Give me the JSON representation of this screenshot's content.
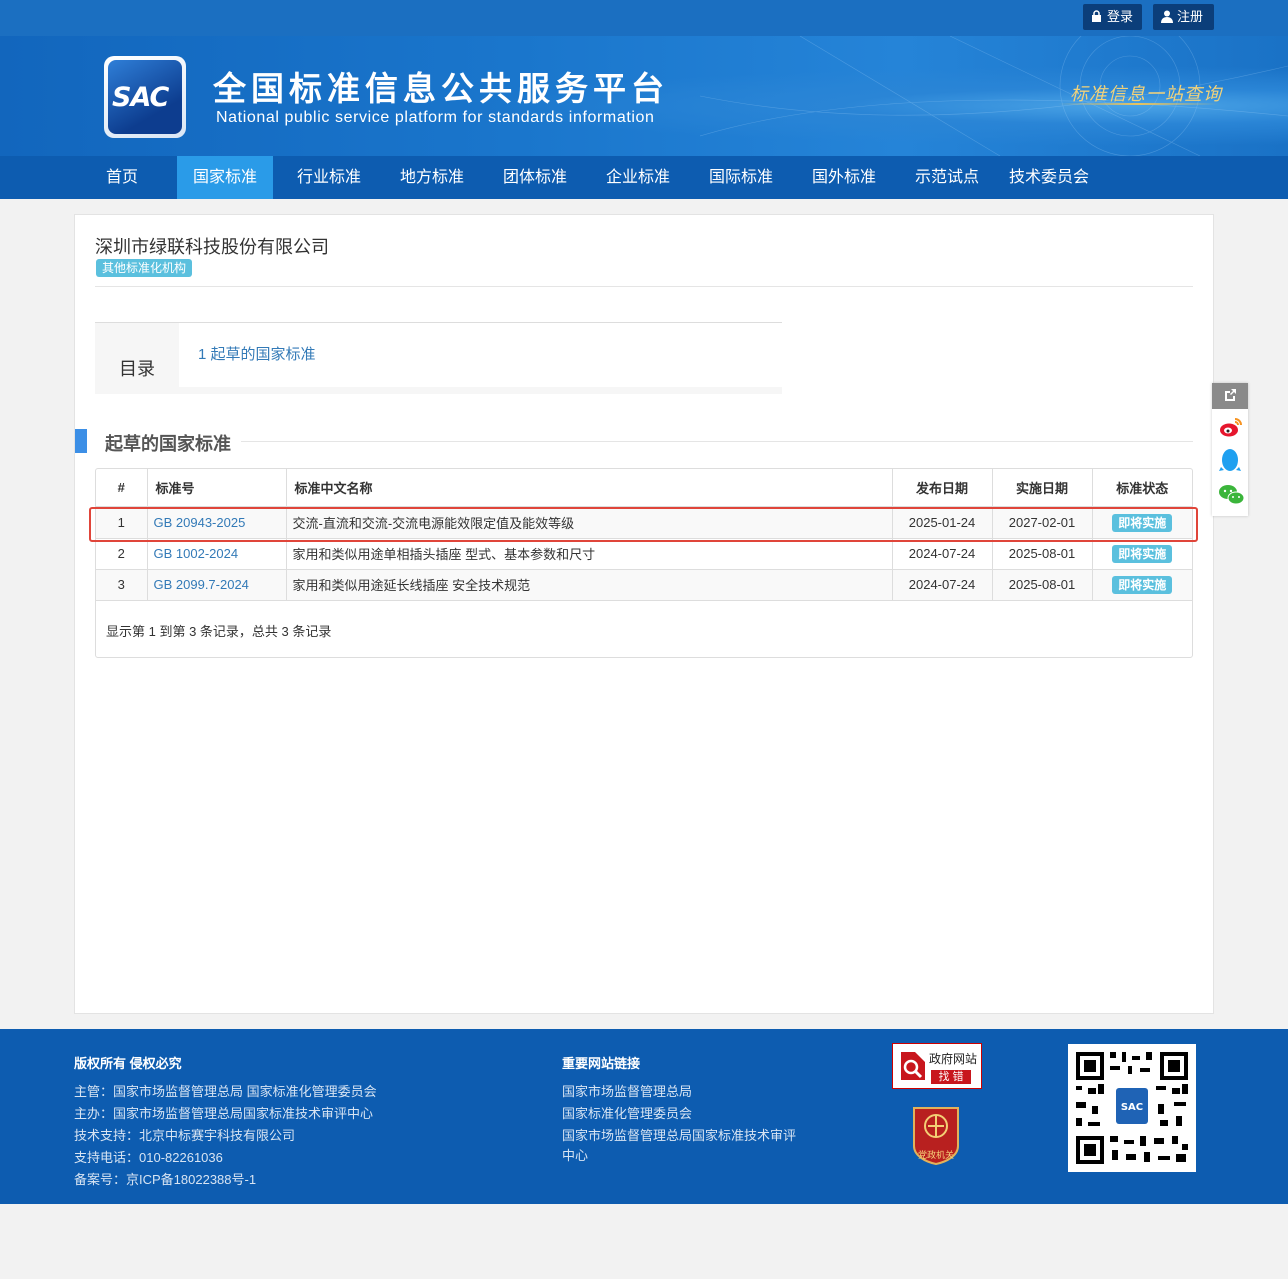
{
  "auth": {
    "login_label": "登录",
    "register_label": "注册"
  },
  "header": {
    "logo_text": "SAC",
    "title": "全国标准信息公共服务平台",
    "subtitle": "National public service platform  for standards information",
    "slogan": "标准信息一站查询"
  },
  "nav": {
    "items": [
      {
        "label": "首页"
      },
      {
        "label": "国家标准",
        "active": true
      },
      {
        "label": "行业标准"
      },
      {
        "label": "地方标准"
      },
      {
        "label": "团体标准"
      },
      {
        "label": "企业标准"
      },
      {
        "label": "国际标准"
      },
      {
        "label": "国外标准"
      },
      {
        "label": "示范试点"
      },
      {
        "label": "技术委员会"
      }
    ]
  },
  "org": {
    "name": "深圳市绿联科技股份有限公司",
    "tag": "其他标准化机构"
  },
  "toc": {
    "label": "目录",
    "link": "1  起草的国家标准"
  },
  "section": {
    "title": "起草的国家标准"
  },
  "table": {
    "headers": [
      "#",
      "标准号",
      "标准中文名称",
      "发布日期",
      "实施日期",
      "标准状态"
    ],
    "rows": [
      {
        "num": "1",
        "code": "GB 20943-2025",
        "name": "交流-直流和交流-交流电源能效限定值及能效等级",
        "publish": "2025-01-24",
        "implement": "2027-02-01",
        "status": "即将实施"
      },
      {
        "num": "2",
        "code": "GB 1002-2024",
        "name": "家用和类似用途单相插头插座 型式、基本参数和尺寸",
        "publish": "2024-07-24",
        "implement": "2025-08-01",
        "status": "即将实施"
      },
      {
        "num": "3",
        "code": "GB 2099.7-2024",
        "name": "家用和类似用途延长线插座 安全技术规范",
        "publish": "2024-07-24",
        "implement": "2025-08-01",
        "status": "即将实施"
      }
    ],
    "info": "显示第 1 到第 3 条记录，总共 3 条记录"
  },
  "footer": {
    "copyright_title": "版权所有 侵权必究",
    "lines": [
      "主管：国家市场监督管理总局 国家标准化管理委员会",
      "主办：国家市场监督管理总局国家标准技术审评中心",
      "技术支持：北京中标赛宇科技有限公司",
      "支持电话：010-82261036",
      "备案号：京ICP备18022388号-1"
    ],
    "links_title": "重要网站链接",
    "links": [
      "国家市场监督管理总局",
      "国家标准化管理委员会",
      "国家市场监督管理总局国家标准技术审评",
      "中心"
    ],
    "gov_badge_top": "政府网站",
    "gov_badge_bottom": "找 错",
    "party_badge": "党政机关",
    "qr_label": "SAC"
  },
  "colors": {
    "primary": "#0d5cb0",
    "nav_active": "#2a9be8",
    "link": "#337ab7",
    "badge": "#5bc0de",
    "highlight": "#e0453a"
  }
}
